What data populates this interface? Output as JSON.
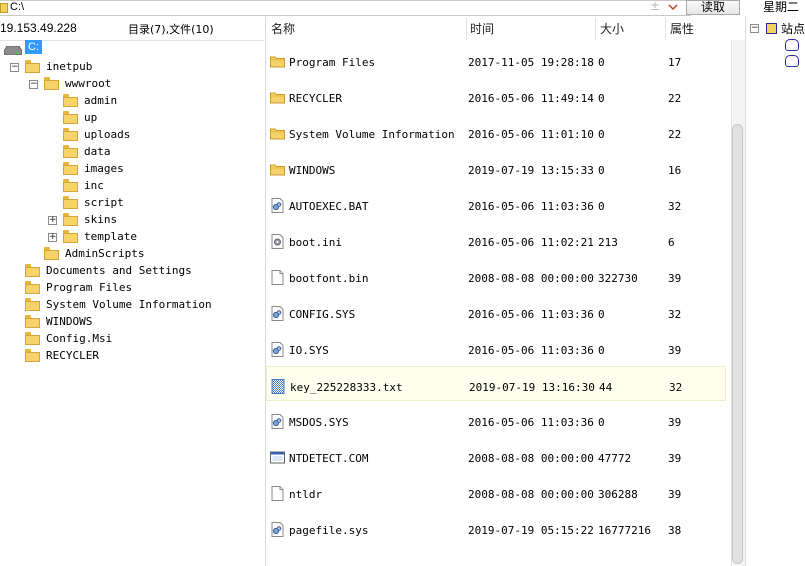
{
  "address_bar": {
    "path": "C:\\",
    "plus_symbol": "±"
  },
  "read_button": {
    "label": "读取"
  },
  "date_label": "星期二",
  "left_pane": {
    "ip": "19.153.49.228",
    "counts": "目录(7),文件(10)",
    "drive": "C:",
    "tree": [
      {
        "label": "inetpub",
        "expander": "−"
      },
      {
        "label": "wwwroot",
        "expander": "−"
      },
      {
        "label": "admin",
        "expander": ""
      },
      {
        "label": "up",
        "expander": ""
      },
      {
        "label": "uploads",
        "expander": ""
      },
      {
        "label": "data",
        "expander": ""
      },
      {
        "label": "images",
        "expander": ""
      },
      {
        "label": "inc",
        "expander": ""
      },
      {
        "label": "script",
        "expander": ""
      },
      {
        "label": "skins",
        "expander": "+"
      },
      {
        "label": "template",
        "expander": "+"
      },
      {
        "label": "AdminScripts",
        "expander": ""
      },
      {
        "label": "Documents and Settings",
        "expander": ""
      },
      {
        "label": "Program Files",
        "expander": ""
      },
      {
        "label": "System Volume Information",
        "expander": ""
      },
      {
        "label": "WINDOWS",
        "expander": ""
      },
      {
        "label": "Config.Msi",
        "expander": ""
      },
      {
        "label": "RECYCLER",
        "expander": ""
      }
    ]
  },
  "file_list": {
    "headers": {
      "name": "名称",
      "time": "时间",
      "size": "大小",
      "attr": "属性"
    },
    "rows": [
      {
        "name": "Program Files",
        "time": "2017-11-05 19:28:18",
        "size": "0",
        "attr": "17",
        "icon": "folder-icon",
        "selected": false
      },
      {
        "name": "RECYCLER",
        "time": "2016-05-06 11:49:14",
        "size": "0",
        "attr": "22",
        "icon": "folder-icon",
        "selected": false
      },
      {
        "name": "System Volume Information",
        "time": "2016-05-06 11:01:10",
        "size": "0",
        "attr": "22",
        "icon": "folder-icon",
        "selected": false
      },
      {
        "name": "WINDOWS",
        "time": "2019-07-19 13:15:33",
        "size": "0",
        "attr": "16",
        "icon": "folder-icon",
        "selected": false
      },
      {
        "name": "AUTOEXEC.BAT",
        "time": "2016-05-06 11:03:36",
        "size": "0",
        "attr": "32",
        "icon": "batch-file-icon",
        "selected": false
      },
      {
        "name": "boot.ini",
        "time": "2016-05-06 11:02:21",
        "size": "213",
        "attr": "6",
        "icon": "settings-file-icon",
        "selected": false
      },
      {
        "name": "bootfont.bin",
        "time": "2008-08-08 00:00:00",
        "size": "322730",
        "attr": "39",
        "icon": "blank-file-icon",
        "selected": false
      },
      {
        "name": "CONFIG.SYS",
        "time": "2016-05-06 11:03:36",
        "size": "0",
        "attr": "32",
        "icon": "system-file-icon",
        "selected": false
      },
      {
        "name": "IO.SYS",
        "time": "2016-05-06 11:03:36",
        "size": "0",
        "attr": "39",
        "icon": "system-file-icon",
        "selected": false
      },
      {
        "name": "key_225228333.txt",
        "time": "2019-07-19 13:16:30",
        "size": "44",
        "attr": "32",
        "icon": "text-file-icon",
        "selected": true
      },
      {
        "name": "MSDOS.SYS",
        "time": "2016-05-06 11:03:36",
        "size": "0",
        "attr": "39",
        "icon": "system-file-icon",
        "selected": false
      },
      {
        "name": "NTDETECT.COM",
        "time": "2008-08-08 00:00:00",
        "size": "47772",
        "attr": "39",
        "icon": "executable-file-icon",
        "selected": false
      },
      {
        "name": "ntldr",
        "time": "2008-08-08 00:00:00",
        "size": "306288",
        "attr": "39",
        "icon": "blank-file-icon",
        "selected": false
      },
      {
        "name": "pagefile.sys",
        "time": "2019-07-19 05:15:22",
        "size": "16777216",
        "attr": "38",
        "icon": "system-file-icon",
        "selected": false
      }
    ]
  },
  "right_pane": {
    "node_label": "站点",
    "node_expander": "−"
  },
  "colors": {
    "selection_blue": "#3399ff",
    "folder_yellow": "#f6d36a",
    "selected_row_bg": "#fffff0"
  }
}
